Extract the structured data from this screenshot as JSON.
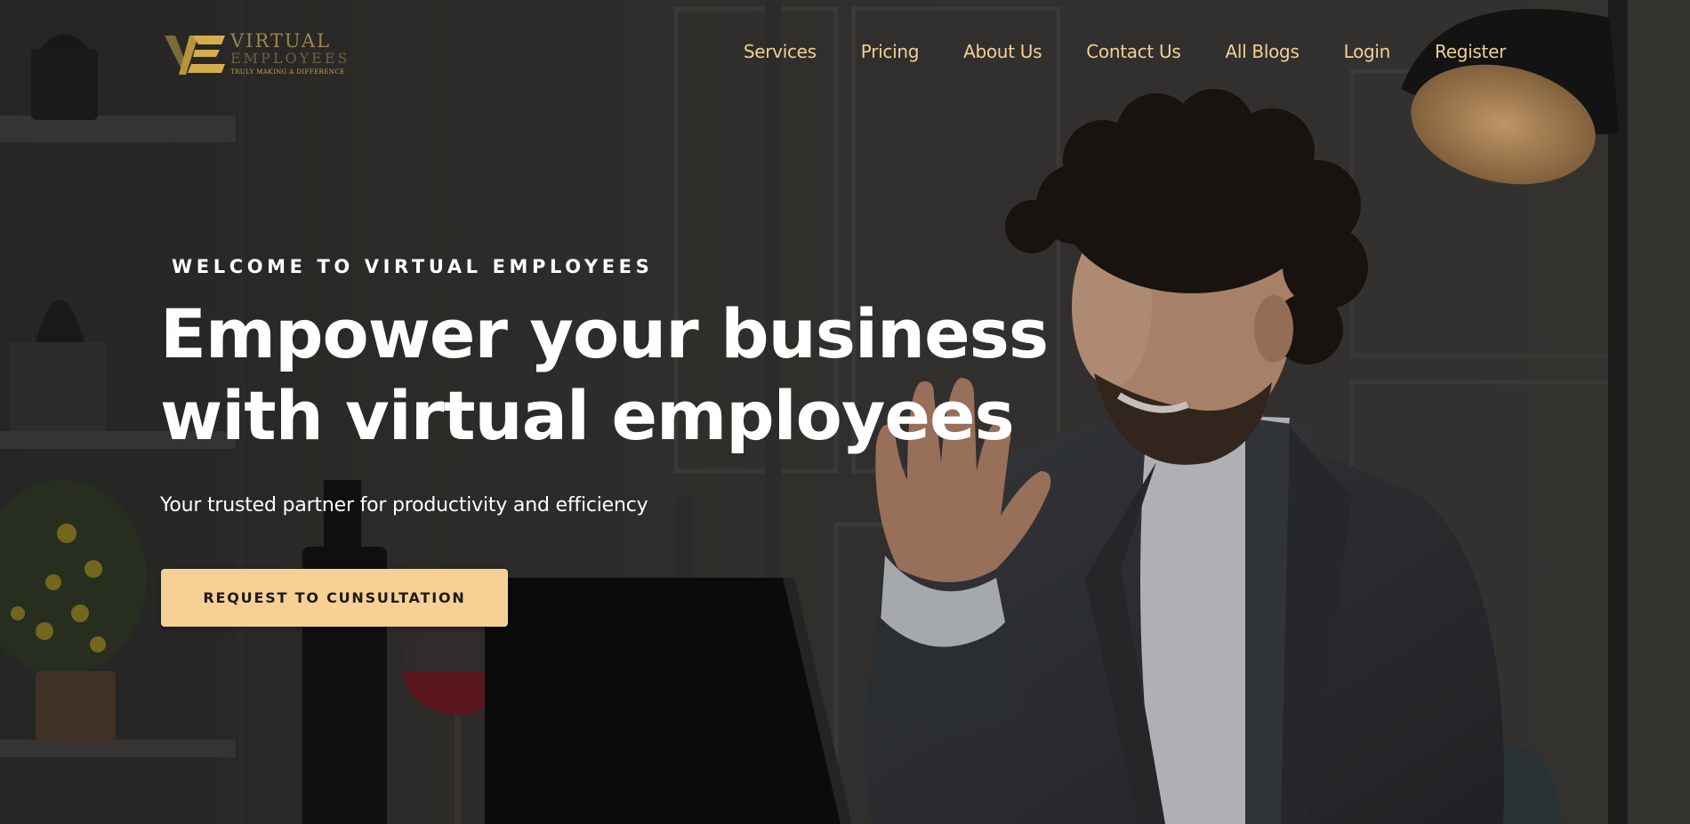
{
  "header": {
    "logo": {
      "line1": "VIRTUAL",
      "line2": "EMPLOYEES",
      "tagline": "TRULY MAKING A DIFFERENCE"
    },
    "nav": [
      {
        "label": "Services"
      },
      {
        "label": "Pricing"
      },
      {
        "label": "About Us"
      },
      {
        "label": "Contact Us"
      },
      {
        "label": "All Blogs"
      },
      {
        "label": "Login"
      },
      {
        "label": "Register"
      }
    ]
  },
  "hero": {
    "eyebrow": "WELCOME TO VIRTUAL EMPLOYEES",
    "headline_line1": "Empower your business",
    "headline_line2": "with virtual employees",
    "subtitle": "Your trusted partner for productivity and efficiency",
    "cta_label": "REQUEST TO CUNSULTATION"
  },
  "colors": {
    "accent": "#f7d096",
    "nav_text": "#f2cf94",
    "background": "#2e2d2b",
    "logo_gold": "#c8a24a"
  },
  "icons": {
    "logo_mark": "ve-monogram-icon"
  }
}
